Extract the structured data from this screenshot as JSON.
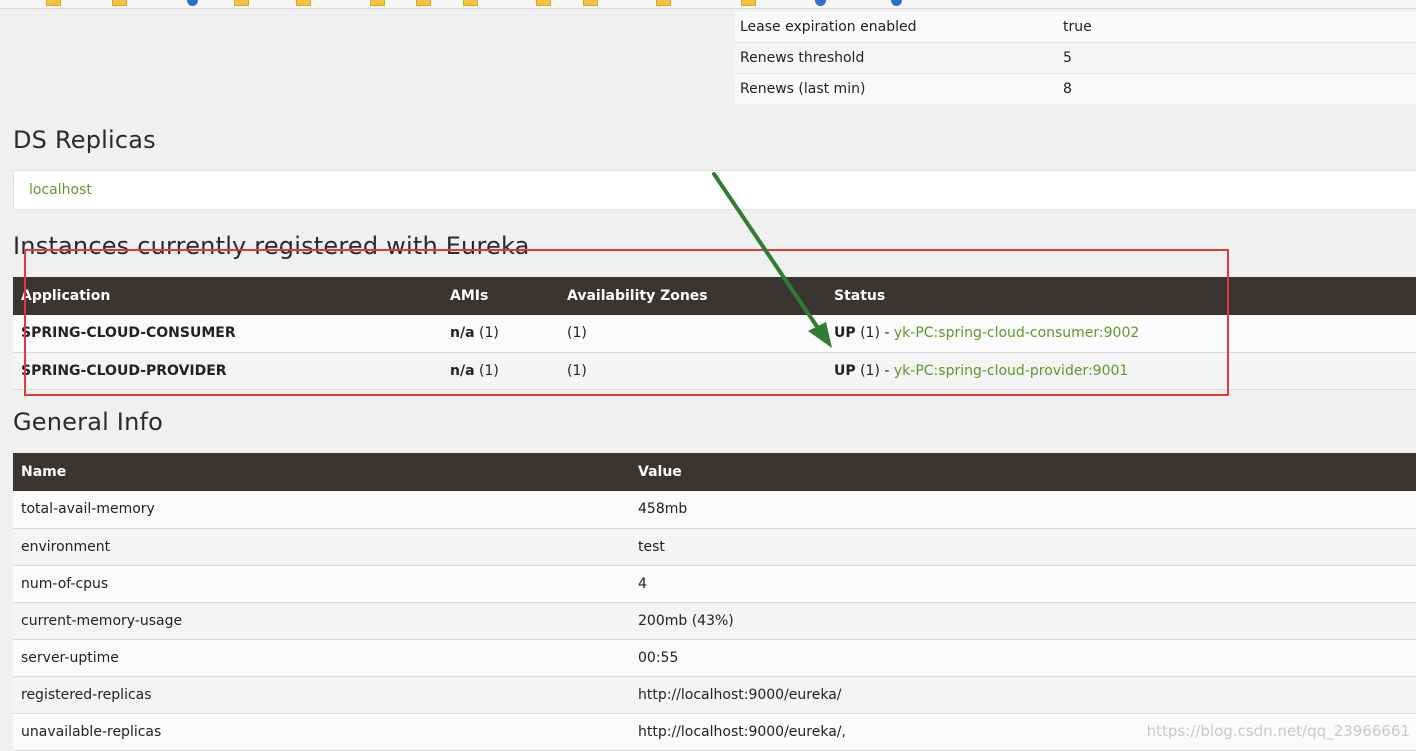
{
  "stats": [
    {
      "name": "Lease expiration enabled",
      "value": "true"
    },
    {
      "name": "Renews threshold",
      "value": "5"
    },
    {
      "name": "Renews (last min)",
      "value": "8"
    }
  ],
  "ds_replicas": {
    "title": "DS Replicas",
    "items": [
      "localhost"
    ]
  },
  "instances": {
    "title": "Instances currently registered with Eureka",
    "columns": [
      "Application",
      "AMIs",
      "Availability Zones",
      "Status"
    ],
    "rows": [
      {
        "application": "SPRING-CLOUD-CONSUMER",
        "amis": "n/a",
        "amis_count": "(1)",
        "zones": "(1)",
        "status": "UP",
        "status_count": "(1) - ",
        "instance": "yk-PC:spring-cloud-consumer:9002"
      },
      {
        "application": "SPRING-CLOUD-PROVIDER",
        "amis": "n/a",
        "amis_count": "(1)",
        "zones": "(1)",
        "status": "UP",
        "status_count": "(1) - ",
        "instance": "yk-PC:spring-cloud-provider:9001"
      }
    ]
  },
  "general_info": {
    "title": "General Info",
    "columns": [
      "Name",
      "Value"
    ],
    "rows": [
      {
        "name": "total-avail-memory",
        "value": "458mb"
      },
      {
        "name": "environment",
        "value": "test"
      },
      {
        "name": "num-of-cpus",
        "value": "4"
      },
      {
        "name": "current-memory-usage",
        "value": "200mb (43%)"
      },
      {
        "name": "server-uptime",
        "value": "00:55"
      },
      {
        "name": "registered-replicas",
        "value": "http://localhost:9000/eureka/"
      },
      {
        "name": "unavailable-replicas",
        "value": "http://localhost:9000/eureka/,"
      }
    ]
  },
  "annotations": {
    "highlight_color": "#e03a3a",
    "arrow_color": "#2e7d32"
  },
  "watermark": "https://blog.csdn.net/qq_23966661",
  "colors": {
    "link": "#5a9a2a",
    "table_header_bg": "#3a3530",
    "page_bg": "#f0f0f0"
  }
}
